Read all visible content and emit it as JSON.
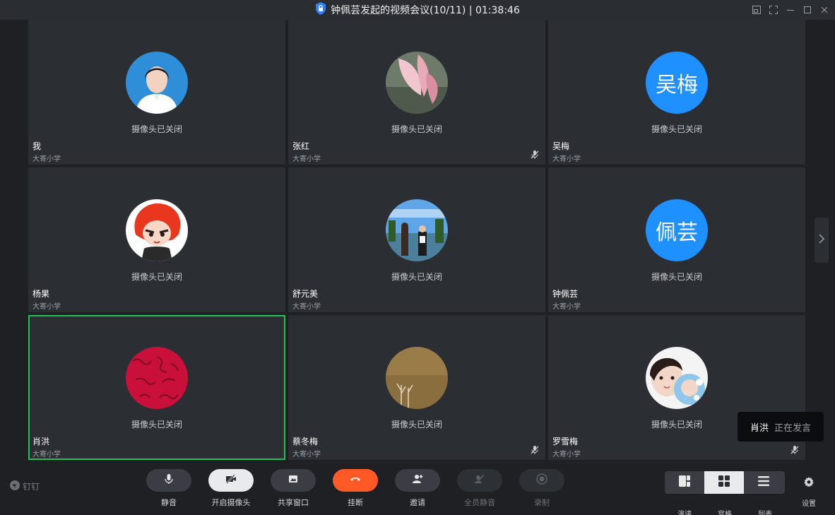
{
  "window": {
    "title": "钟佩芸发起的视频会议(10/11) | 01:38:46"
  },
  "grid": {
    "camera_off_text": "摄像头已关闭",
    "tiles": [
      {
        "name": "我",
        "org": "大寄小学",
        "avatar": "photo-woman",
        "muted": false
      },
      {
        "name": "张红",
        "org": "大寄小学",
        "avatar": "photo-flower",
        "muted": true
      },
      {
        "name": "吴梅",
        "org": "大寄小学",
        "avatar_text": "吴梅",
        "muted": false
      },
      {
        "name": "杨果",
        "org": "大寄小学",
        "avatar": "cartoon-character",
        "muted": false
      },
      {
        "name": "舒元美",
        "org": "大寄小学",
        "avatar": "photo-outdoor",
        "muted": false
      },
      {
        "name": "钟佩芸",
        "org": "大寄小学",
        "avatar_text": "佩芸",
        "muted": false
      },
      {
        "name": "肖洪",
        "org": "大寄小学",
        "avatar": "photo-red-pattern",
        "muted": false,
        "speaking": true
      },
      {
        "name": "蔡冬梅",
        "org": "大寄小学",
        "avatar": "photo-brown",
        "muted": true
      },
      {
        "name": "罗雪梅",
        "org": "大寄小学",
        "avatar": "photo-selfie",
        "muted": true
      }
    ]
  },
  "toast": {
    "speaker": "肖洪",
    "status": "正在发言"
  },
  "toolbar": {
    "brand": "钉钉",
    "mute_label": "静音",
    "camera_label": "开启摄像头",
    "share_label": "共享窗口",
    "hangup_label": "挂断",
    "invite_label": "邀请",
    "mute_all_label": "全员静音",
    "record_label": "录制",
    "view_speaker_label": "演讲",
    "view_grid_label": "宫格",
    "view_list_label": "列表",
    "settings_label": "设置"
  },
  "colors": {
    "accent_blue": "#1e90ff",
    "hangup_red": "#ff5a26",
    "speaking_green": "#1fbf5a"
  }
}
